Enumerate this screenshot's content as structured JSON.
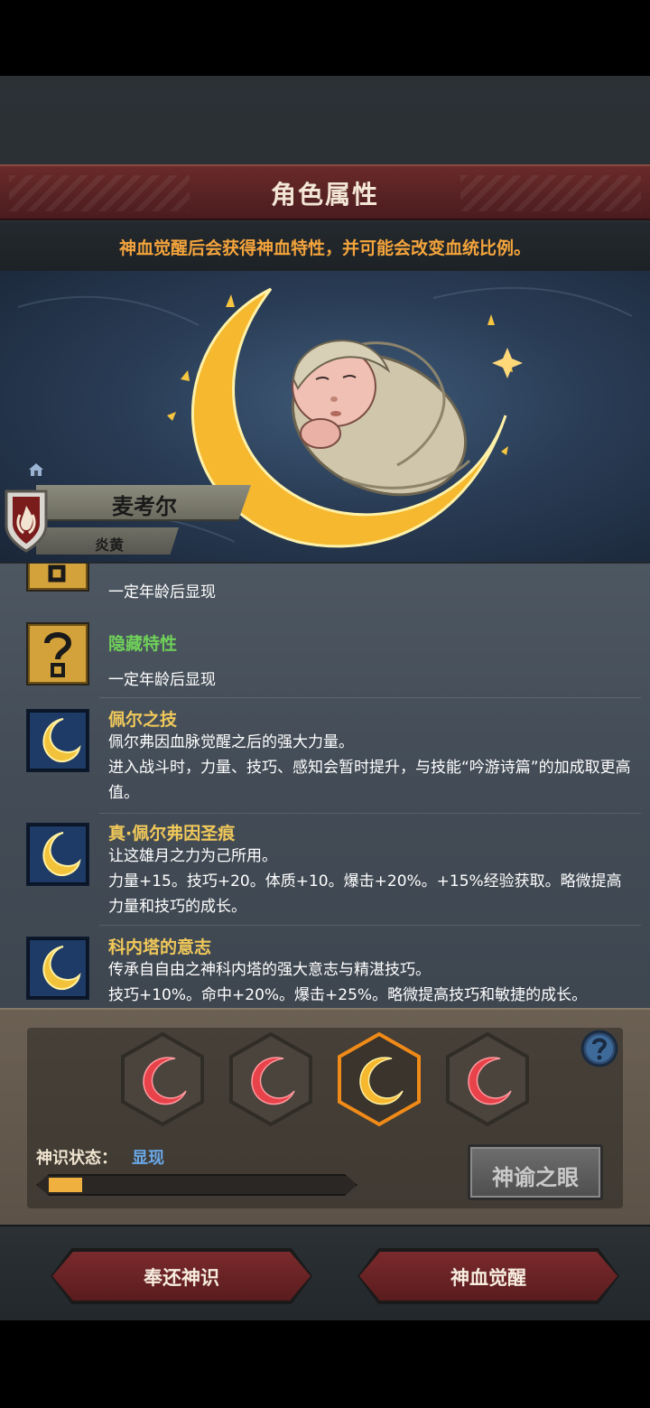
{
  "header": {
    "title": "角色属性",
    "subtitle": "神血觉醒后会获得神血特性，并可能会改变血统比例。"
  },
  "character": {
    "name": "麦考尔",
    "clan": "炎黄"
  },
  "traits": [
    {
      "title": "",
      "desc": "一定年龄后显现",
      "icon": "question-icon",
      "title_color": "green"
    },
    {
      "title": "隐藏特性",
      "desc": "一定年龄后显现",
      "icon": "question-icon",
      "title_color": "green"
    },
    {
      "title": "佩尔之技",
      "desc": "佩尔弗因血脉觉醒之后的强大力量。\n进入战斗时，力量、技巧、感知会暂时提升，与技能“吟游诗篇”的加成取更高值。",
      "icon": "moon-icon",
      "title_color": "gold"
    },
    {
      "title": "真·佩尔弗因圣痕",
      "desc": "让这雄月之力为己所用。\n力量+15。技巧+20。体质+10。爆击+20%。+15%经验获取。略微提高力量和技巧的成长。",
      "icon": "moon-icon",
      "title_color": "gold"
    },
    {
      "title": "科内塔的意志",
      "desc": "传承自自由之神科内塔的强大意志与精湛技巧。\n技巧+10%。命中+20%。爆击+25%。略微提高技巧和敏捷的成长。",
      "icon": "moon-icon",
      "title_color": "gold"
    }
  ],
  "divine_slots": [
    {
      "state": "inactive",
      "color": "#e8424a"
    },
    {
      "state": "inactive",
      "color": "#e8424a"
    },
    {
      "state": "active",
      "color": "#f5b82e"
    },
    {
      "state": "inactive",
      "color": "#e8424a"
    }
  ],
  "status": {
    "label": "神识状态：",
    "value": "显现",
    "progress": 0.11
  },
  "buttons": {
    "oracle": "神谕之眼",
    "return": "奉还神识",
    "awaken": "神血觉醒"
  },
  "colors": {
    "accent_gold": "#f0c85a",
    "subtitle_orange": "#f4a43c",
    "hidden_green": "#6fcf5a",
    "status_blue": "#6aa8e8"
  }
}
